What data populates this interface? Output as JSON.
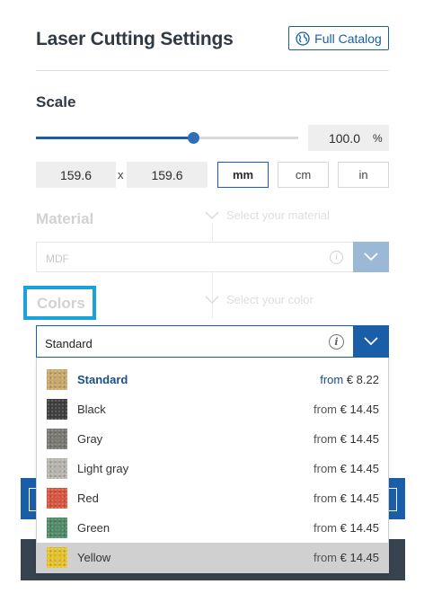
{
  "header": {
    "title": "Laser Cutting Settings",
    "catalog_label": "Full Catalog"
  },
  "scale": {
    "label": "Scale",
    "percent_value": "100.0",
    "percent_unit": "%",
    "slider_fraction": 0.6,
    "width": "159.6",
    "height": "159.6",
    "separator": "x",
    "units": [
      "mm",
      "cm",
      "in"
    ],
    "active_unit": "mm"
  },
  "material": {
    "label": "Material",
    "hint": "Select your material",
    "value": "MDF",
    "info_glyph": "i"
  },
  "colors": {
    "label": "Colors",
    "hint": "Select your color",
    "value": "Standard",
    "info_glyph": "i",
    "options": [
      {
        "name": "Standard",
        "from": "from",
        "price": "€ 8.22",
        "swatch": "#c9a86a",
        "selected": true
      },
      {
        "name": "Black",
        "from": "from",
        "price": "€ 14.45",
        "swatch": "#3e3e3e"
      },
      {
        "name": "Gray",
        "from": "from",
        "price": "€ 14.45",
        "swatch": "#7a7874"
      },
      {
        "name": "Light gray",
        "from": "from",
        "price": "€ 14.45",
        "swatch": "#b7b4ae"
      },
      {
        "name": "Red",
        "from": "from",
        "price": "€ 14.45",
        "swatch": "#d9553f"
      },
      {
        "name": "Green",
        "from": "from",
        "price": "€ 14.45",
        "swatch": "#4f8a66"
      },
      {
        "name": "Yellow",
        "from": "from",
        "price": "€ 14.45",
        "swatch": "#e6c22a",
        "hovered": true
      }
    ]
  },
  "colors_theme": {
    "accent": "#1a5ea8",
    "highlight": "#1aa2dc",
    "dark": "#37434f"
  }
}
